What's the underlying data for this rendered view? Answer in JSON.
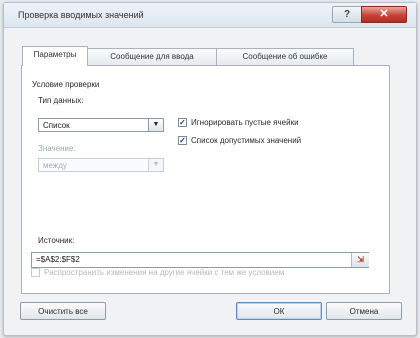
{
  "dialog": {
    "title": "Проверка вводимых значений",
    "help_icon": "question-icon",
    "close_icon": "close-icon"
  },
  "tabs": [
    {
      "label": "Параметры",
      "active": true
    },
    {
      "label": "Сообщение для ввода",
      "active": false
    },
    {
      "label": "Сообщение об ошибке",
      "active": false
    }
  ],
  "params": {
    "section_label": "Условие проверки",
    "data_type_label": "Тип данных:",
    "data_type_value": "Список",
    "value_label": "Значение:",
    "value_value": "между",
    "ignore_blank_label": "Игнорировать пустые ячейки",
    "ignore_blank_checked": true,
    "dropdown_label": "Список допустимых значений",
    "dropdown_checked": true,
    "source_label": "Источник:",
    "source_value": "=$A$2:$F$2",
    "range_icon": "range-select-icon",
    "spread_label": "Распространить изменения на другие ячейки с тем же условием",
    "spread_checked": false
  },
  "buttons": {
    "clear_all": "Очистить все",
    "ok": "ОК",
    "cancel": "Отмена"
  },
  "colors": {
    "close_button": "#c7443a",
    "panel_background": "#ffffff",
    "window_background": "#f0f2f4"
  }
}
